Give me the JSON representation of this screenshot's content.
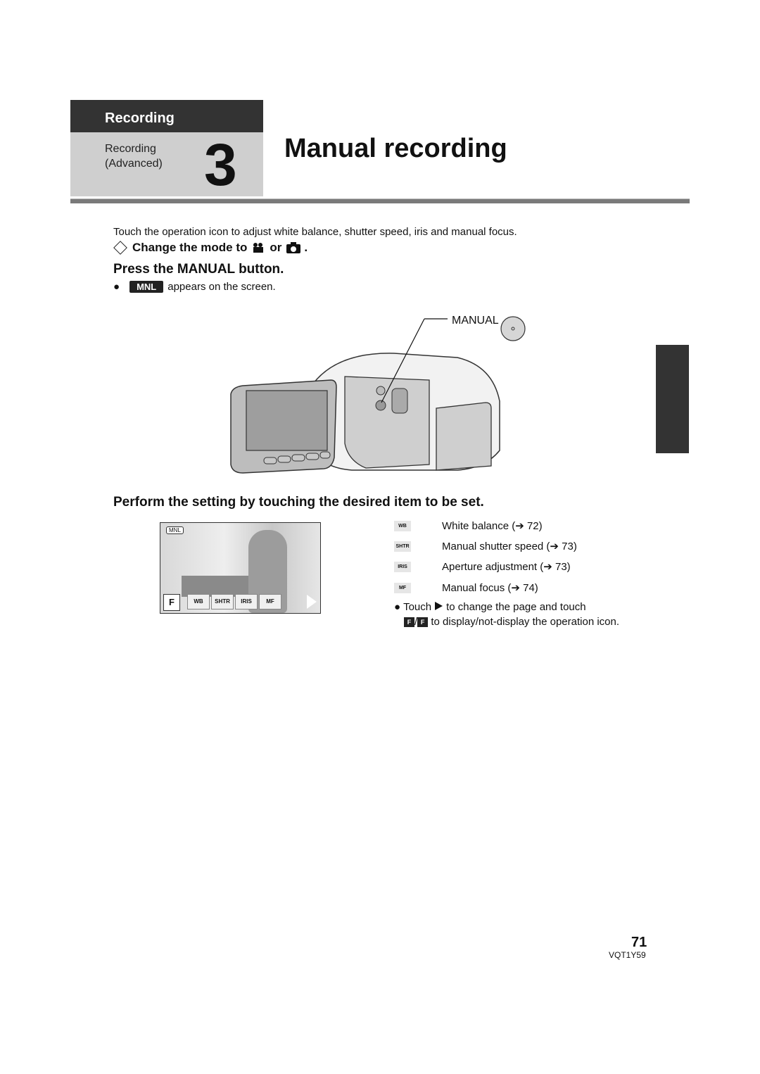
{
  "header": {
    "section": "Recording",
    "subsection_line1": "Recording",
    "subsection_line2": "(Advanced)",
    "chapter_number": "3",
    "title": "Manual recording"
  },
  "intro": "Touch the operation icon to adjust white balance, shutter speed, iris and manual focus.",
  "mode_step": {
    "text": "Change the mode to",
    "or": "or",
    "end": ".",
    "icons": [
      "movie-mode-icon",
      "photo-mode-icon"
    ]
  },
  "step1": {
    "heading": "Press the MANUAL button.",
    "bullet_badge": "MNL",
    "bullet_text": "appears on the screen.",
    "illustration_label": "MANUAL"
  },
  "step2": {
    "heading": "Perform the setting by touching the desired item to be set."
  },
  "lcd": {
    "mnl_tag": "MNL",
    "f_button": "F",
    "buttons": [
      "WB",
      "SHTR",
      "IRIS",
      "MF"
    ]
  },
  "items": [
    {
      "icon": "WB",
      "label": "White balance (➔ 72)"
    },
    {
      "icon": "SHTR",
      "label": "Manual shutter speed (➔ 73)"
    },
    {
      "icon": "IRIS",
      "label": "Aperture adjustment (➔ 73)"
    },
    {
      "icon": "MF",
      "label": "Manual focus (➔ 74)"
    }
  ],
  "note": {
    "part1": "Touch",
    "part2": "to change the page and touch",
    "part3": "to display/not-display the operation icon.",
    "icon_f": "F"
  },
  "footer": {
    "page_number": "71",
    "doc_code": "VQT1Y59"
  }
}
